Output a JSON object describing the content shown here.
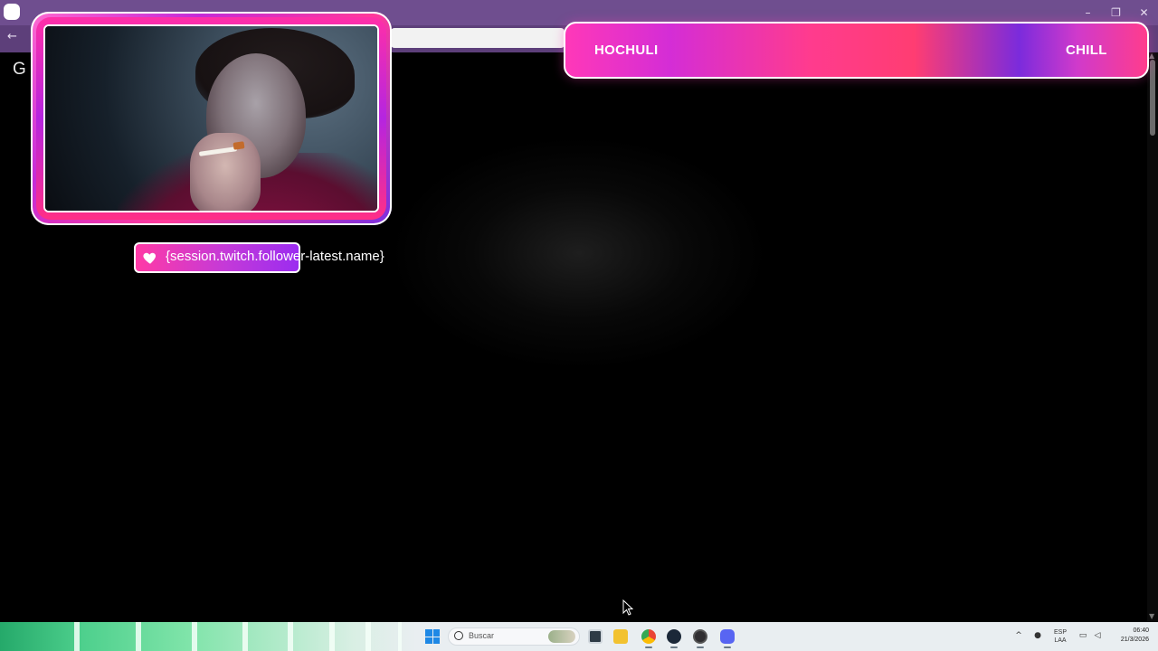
{
  "browser": {
    "controls": {
      "minimize": "–",
      "restore": "❐",
      "close": "✕"
    },
    "back": "←",
    "app_letter": "G"
  },
  "overlay": {
    "follower_text": "{session.twitch.follower-latest.name}",
    "banner": {
      "left": "HOCHULI",
      "right": "CHILL"
    }
  },
  "taskbar": {
    "search_placeholder": "Buscar",
    "language": [
      "ESP",
      "LAA"
    ],
    "time": "06:40",
    "date": "21/3/2026",
    "icons": [
      "start-icon",
      "search-icon",
      "task-view-icon",
      "file-explorer-icon",
      "chrome-icon",
      "steam-icon",
      "obs-icon",
      "discord-icon",
      "chevron-up-icon",
      "microphone-icon",
      "network-icon",
      "volume-icon"
    ]
  },
  "colors": {
    "chrome_purple": "#6f4e8f",
    "overlay_pink": "#ff3aa6",
    "overlay_violet": "#9b2cf0",
    "taskbar_bg": "#e9eef1"
  }
}
